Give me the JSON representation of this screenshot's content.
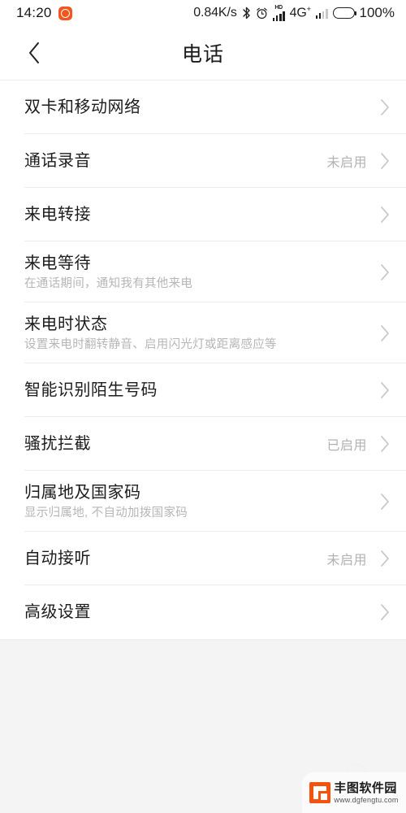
{
  "status_bar": {
    "time": "14:20",
    "app_icon": "clock-app-icon",
    "network_speed": "0.84K/s",
    "bluetooth_icon": "bluetooth-icon",
    "alarm_icon": "alarm-clock-icon",
    "hd_label": "HD",
    "signal_icon": "signal-bars-icon",
    "network_type": "4G",
    "network_type_sup": "+",
    "signal2_icon": "signal-bars-secondary-icon",
    "battery_icon": "battery-full-icon",
    "battery_percent": "100%"
  },
  "header": {
    "back_icon": "back-chevron-icon",
    "title": "电话"
  },
  "list": {
    "chevron_icon": "chevron-right-icon",
    "items": [
      {
        "title": "双卡和移动网络",
        "subtitle": "",
        "value": ""
      },
      {
        "title": "通话录音",
        "subtitle": "",
        "value": "未启用"
      },
      {
        "title": "来电转接",
        "subtitle": "",
        "value": ""
      },
      {
        "title": "来电等待",
        "subtitle": "在通话期间，通知我有其他来电",
        "value": ""
      },
      {
        "title": "来电时状态",
        "subtitle": "设置来电时翻转静音、启用闪光灯或距离感应等",
        "value": ""
      },
      {
        "title": "智能识别陌生号码",
        "subtitle": "",
        "value": ""
      },
      {
        "title": "骚扰拦截",
        "subtitle": "",
        "value": "已启用"
      },
      {
        "title": "归属地及国家码",
        "subtitle": "显示归属地, 不自动加拨国家码",
        "value": ""
      },
      {
        "title": "自动接听",
        "subtitle": "",
        "value": "未启用"
      },
      {
        "title": "高级设置",
        "subtitle": "",
        "value": ""
      }
    ]
  },
  "watermark": {
    "logo_icon": "fengtu-logo-icon",
    "name": "丰图软件园",
    "url": "www.dgfengtu.com"
  },
  "colors": {
    "page_background": "#f4f4f4",
    "surface": "#ffffff",
    "primary_text": "#1c1c1c",
    "secondary_text": "#b6b6b6",
    "divider": "#ededed",
    "accent_orange": "#f2540d"
  }
}
